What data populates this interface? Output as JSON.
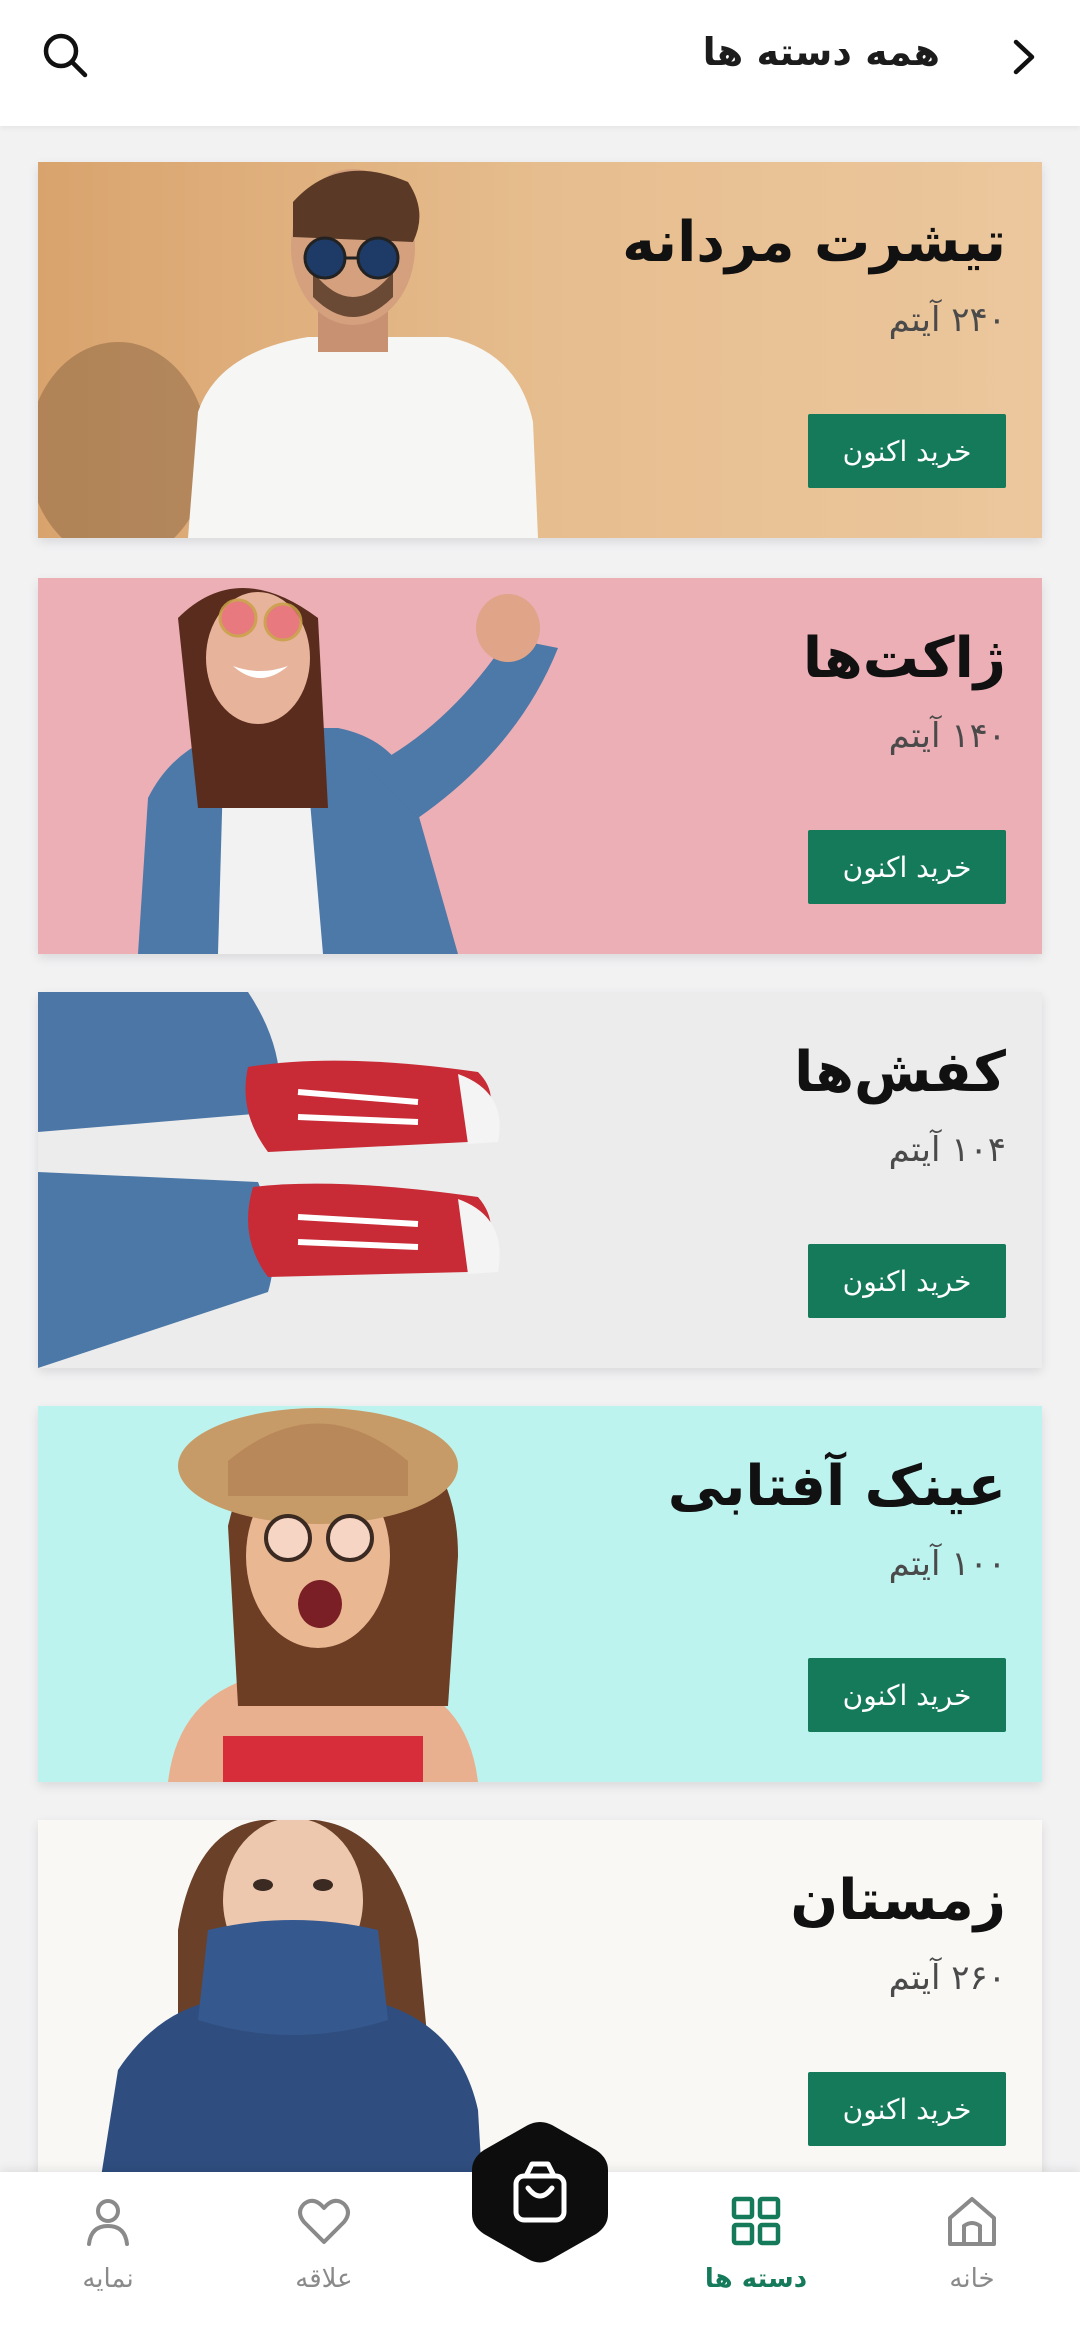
{
  "header": {
    "title": "همه دسته ها"
  },
  "icons": {
    "search": "search-icon",
    "back": "chevron-right-icon",
    "home": "home-icon",
    "categories": "grid-icon",
    "cart": "shopping-bag-icon",
    "favorites": "heart-icon",
    "profile": "user-icon"
  },
  "colors": {
    "accent": "#157a5a",
    "card_tshirt_bg": "#e9c49a",
    "card_jackets_bg": "#ecafb6",
    "card_shoes_bg": "#ececec",
    "card_sunglasses_bg": "#bdf3ee",
    "card_winter_bg": "#f9f8f5"
  },
  "categories": [
    {
      "title": "تیشرت مردانه",
      "count": "۲۴۰ آیتم",
      "button": "خرید اکنون"
    },
    {
      "title": "ژاکت‌ها",
      "count": "۱۴۰ آیتم",
      "button": "خرید اکنون"
    },
    {
      "title": "کفش‌ها",
      "count": "۱۰۴ آیتم",
      "button": "خرید اکنون"
    },
    {
      "title": "عینک آفتابی",
      "count": "۱۰۰ آیتم",
      "button": "خرید اکنون"
    },
    {
      "title": "زمستان",
      "count": "۲۶۰ آیتم",
      "button": "خرید اکنون"
    }
  ],
  "bottom_nav": {
    "home": "خانه",
    "categories": "دسته ها",
    "favorites": "علاقه",
    "profile": "نمایه"
  }
}
